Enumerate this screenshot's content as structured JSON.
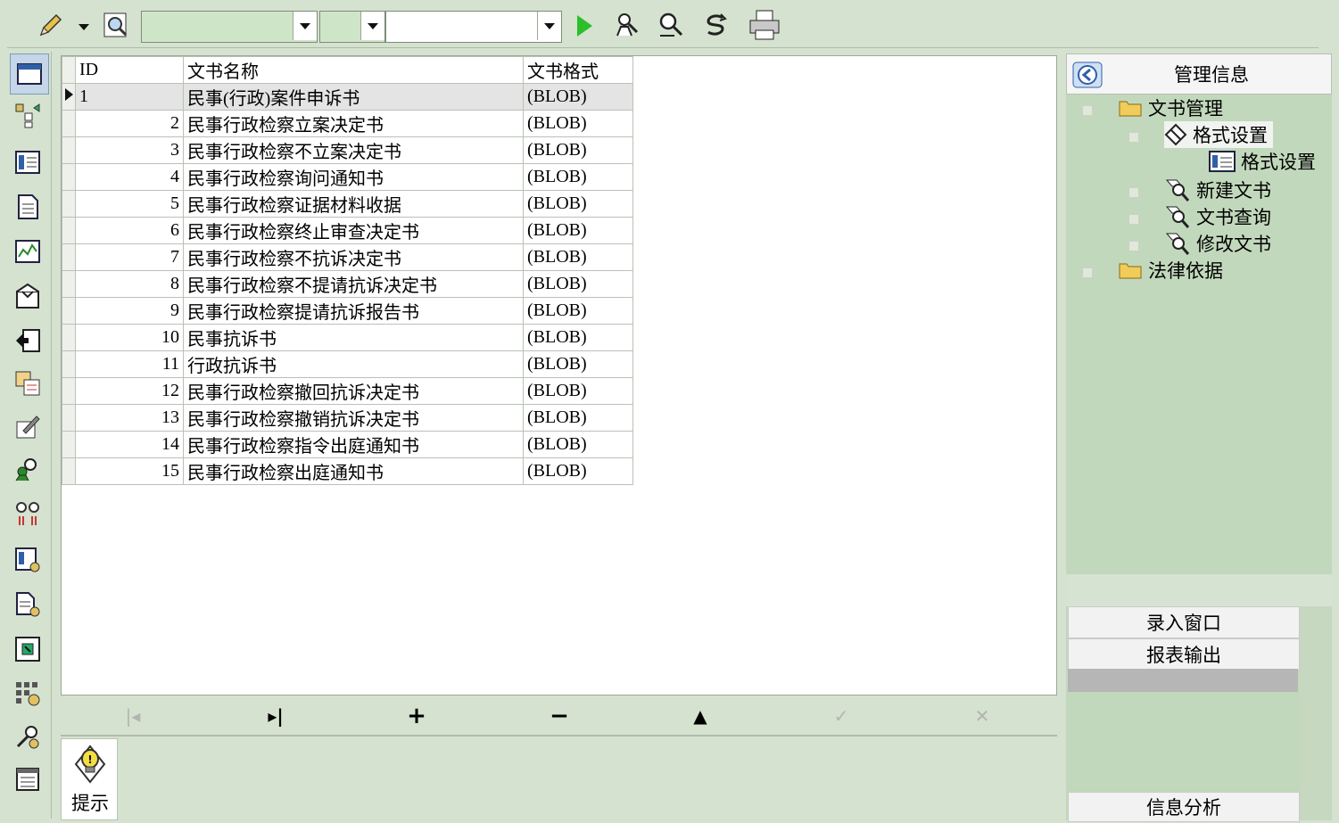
{
  "toolbar": {
    "icons": [
      "pencil-icon",
      "dropdown-arrow-icon",
      "find-icon",
      "play-icon",
      "search-people-icon",
      "search-icon",
      "refresh-icon",
      "print-icon"
    ],
    "combo1_value": "",
    "combo2_value": "",
    "combo3_value": ""
  },
  "leftbar": {
    "icons": [
      "window-icon",
      "tree-icon",
      "list-icon",
      "document-icon",
      "chart-icon",
      "envelope-icon",
      "export-icon",
      "copy-icon",
      "edit-icon",
      "users-icon",
      "link-icon",
      "report-icon",
      "report2-icon",
      "grid-icon",
      "apps-icon",
      "tools-icon",
      "table-icon"
    ]
  },
  "grid": {
    "columns": [
      "ID",
      "文书名称",
      "文书格式"
    ],
    "rows": [
      {
        "id": "1",
        "name": "民事(行政)案件申诉书",
        "format": "(BLOB)"
      },
      {
        "id": "2",
        "name": "民事行政检察立案决定书",
        "format": "(BLOB)"
      },
      {
        "id": "3",
        "name": "民事行政检察不立案决定书",
        "format": "(BLOB)"
      },
      {
        "id": "4",
        "name": "民事行政检察询问通知书",
        "format": "(BLOB)"
      },
      {
        "id": "5",
        "name": "民事行政检察证据材料收据",
        "format": "(BLOB)"
      },
      {
        "id": "6",
        "name": "民事行政检察终止审查决定书",
        "format": "(BLOB)"
      },
      {
        "id": "7",
        "name": "民事行政检察不抗诉决定书",
        "format": "(BLOB)"
      },
      {
        "id": "8",
        "name": "民事行政检察不提请抗诉决定书",
        "format": "(BLOB)"
      },
      {
        "id": "9",
        "name": "民事行政检察提请抗诉报告书",
        "format": "(BLOB)"
      },
      {
        "id": "10",
        "name": "民事抗诉书",
        "format": "(BLOB)"
      },
      {
        "id": "11",
        "name": "行政抗诉书",
        "format": "(BLOB)"
      },
      {
        "id": "12",
        "name": "民事行政检察撤回抗诉决定书",
        "format": "(BLOB)"
      },
      {
        "id": "13",
        "name": "民事行政检察撤销抗诉决定书",
        "format": "(BLOB)"
      },
      {
        "id": "14",
        "name": "民事行政检察指令出庭通知书",
        "format": "(BLOB)"
      },
      {
        "id": "15",
        "name": "民事行政检察出庭通知书",
        "format": "(BLOB)"
      }
    ]
  },
  "navigator": {
    "first": "|◂",
    "last": "▸|",
    "insert": "+",
    "delete": "−",
    "edit": "▲",
    "post": "✓",
    "cancel": "✕"
  },
  "hint": {
    "label": "提示"
  },
  "right_panel": {
    "title": "管理信息",
    "tree": {
      "doc_mgmt": "文书管理",
      "format_settings": "格式设置",
      "format_settings_child": "格式设置",
      "new_doc": "新建文书",
      "query_doc": "文书查询",
      "modify_doc": "修改文书",
      "legal_basis": "法律依据"
    },
    "buttons": {
      "entry_window": "录入窗口",
      "report_output": "报表输出",
      "info_analysis": "信息分析"
    }
  }
}
